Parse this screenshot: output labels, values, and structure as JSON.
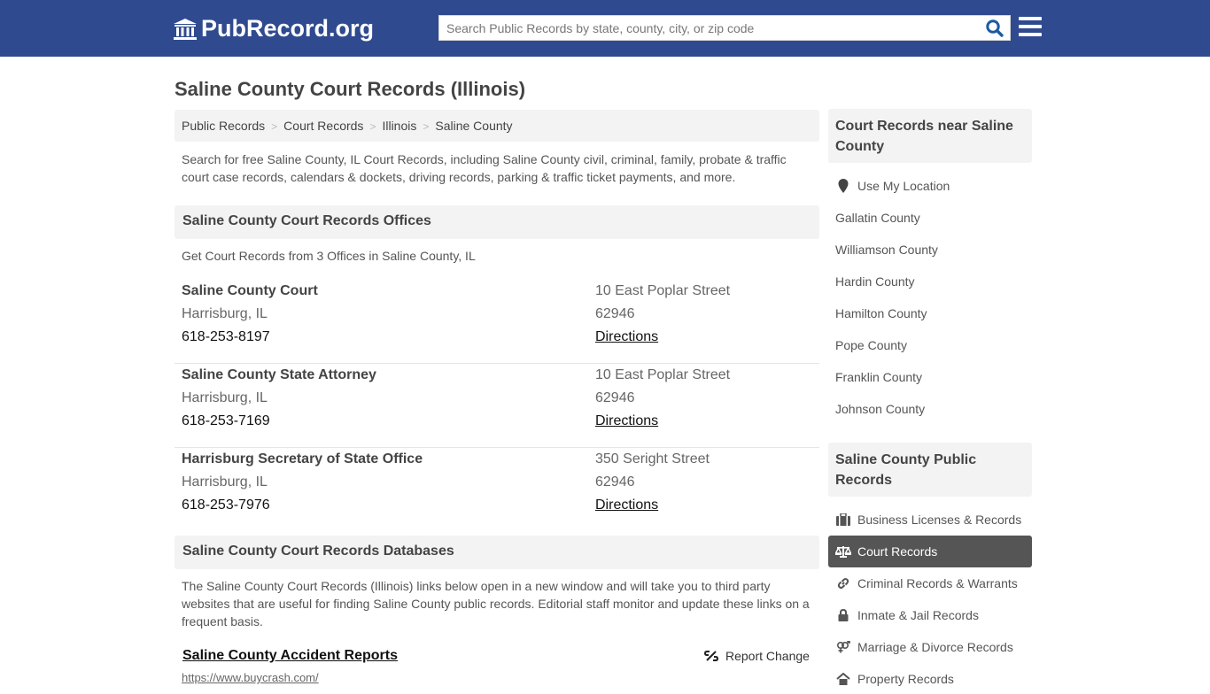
{
  "header": {
    "logo_text": "PubRecord.org",
    "search_placeholder": "Search Public Records by state, county, city, or zip code",
    "search_value": ""
  },
  "page_title": "Saline County Court Records (Illinois)",
  "breadcrumb": [
    "Public Records",
    "Court Records",
    "Illinois",
    "Saline County"
  ],
  "intro": "Search for free Saline County, IL Court Records, including Saline County civil, criminal, family, probate & traffic court case records, calendars & dockets, driving records, parking & traffic ticket payments, and more.",
  "offices": {
    "heading": "Saline County Court Records Offices",
    "subtitle": "Get Court Records from 3 Offices in Saline County, IL",
    "items": [
      {
        "name": "Saline County Court",
        "city": "Harrisburg, IL",
        "phone": "618-253-8197",
        "address": "10 East Poplar Street",
        "zip": "62946",
        "directions": "Directions"
      },
      {
        "name": "Saline County State Attorney",
        "city": "Harrisburg, IL",
        "phone": "618-253-7169",
        "address": "10 East Poplar Street",
        "zip": "62946",
        "directions": "Directions"
      },
      {
        "name": "Harrisburg Secretary of State Office",
        "city": "Harrisburg, IL",
        "phone": "618-253-7976",
        "address": "350 Seright Street",
        "zip": "62946",
        "directions": "Directions"
      }
    ]
  },
  "databases": {
    "heading": "Saline County Court Records Databases",
    "intro": "The Saline County Court Records (Illinois) links below open in a new window and will take you to third party websites that are useful for finding Saline County public records. Editorial staff monitor and update these links on a frequent basis.",
    "items": [
      {
        "title": "Saline County Accident Reports",
        "url": "https://www.buycrash.com/",
        "report_label": "Report Change"
      }
    ]
  },
  "sidebar": {
    "nearby": {
      "heading": "Court Records near Saline County",
      "use_location": "Use My Location",
      "counties": [
        "Gallatin County",
        "Williamson County",
        "Hardin County",
        "Hamilton County",
        "Pope County",
        "Franklin County",
        "Johnson County"
      ]
    },
    "public_records": {
      "heading": "Saline County Public Records",
      "items": [
        {
          "label": "Business Licenses & Records",
          "icon": "briefcase-icon",
          "active": false
        },
        {
          "label": "Court Records",
          "icon": "scales-icon",
          "active": true
        },
        {
          "label": "Criminal Records & Warrants",
          "icon": "link-icon",
          "active": false
        },
        {
          "label": "Inmate & Jail Records",
          "icon": "lock-icon",
          "active": false
        },
        {
          "label": "Marriage & Divorce Records",
          "icon": "venus-mars-icon",
          "active": false
        },
        {
          "label": "Property Records",
          "icon": "home-icon",
          "active": false
        }
      ]
    }
  },
  "colors": {
    "header_bg": "#2f4a8f",
    "search_icon": "#1e5aa0",
    "active_item_bg": "#555555"
  }
}
